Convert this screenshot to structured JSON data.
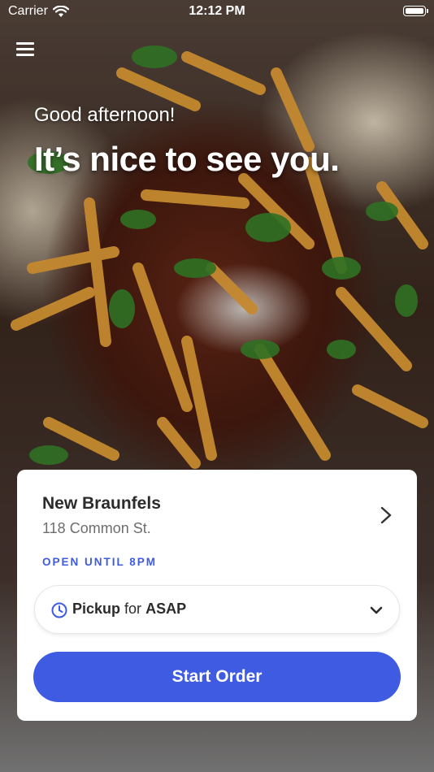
{
  "status_bar": {
    "carrier": "Carrier",
    "time": "12:12 PM",
    "icons": [
      "wifi-icon",
      "battery-icon"
    ]
  },
  "header": {
    "menu_icon": "hamburger-menu-icon",
    "greeting": "Good afternoon!",
    "headline": "It’s nice to see you."
  },
  "location": {
    "name": "New Braunfels",
    "address": "118 Common St.",
    "hours": "OPEN UNTIL 8PM"
  },
  "order_mode": {
    "mode": "Pickup",
    "for_label": "for",
    "time": "ASAP",
    "icons": [
      "clock-icon",
      "chevron-down-icon"
    ]
  },
  "actions": {
    "start_order": "Start Order"
  },
  "colors": {
    "accent": "#3f5be2",
    "card_bg": "#ffffff",
    "title_text": "#2b2b2b",
    "secondary_text": "#6d6d6d"
  }
}
